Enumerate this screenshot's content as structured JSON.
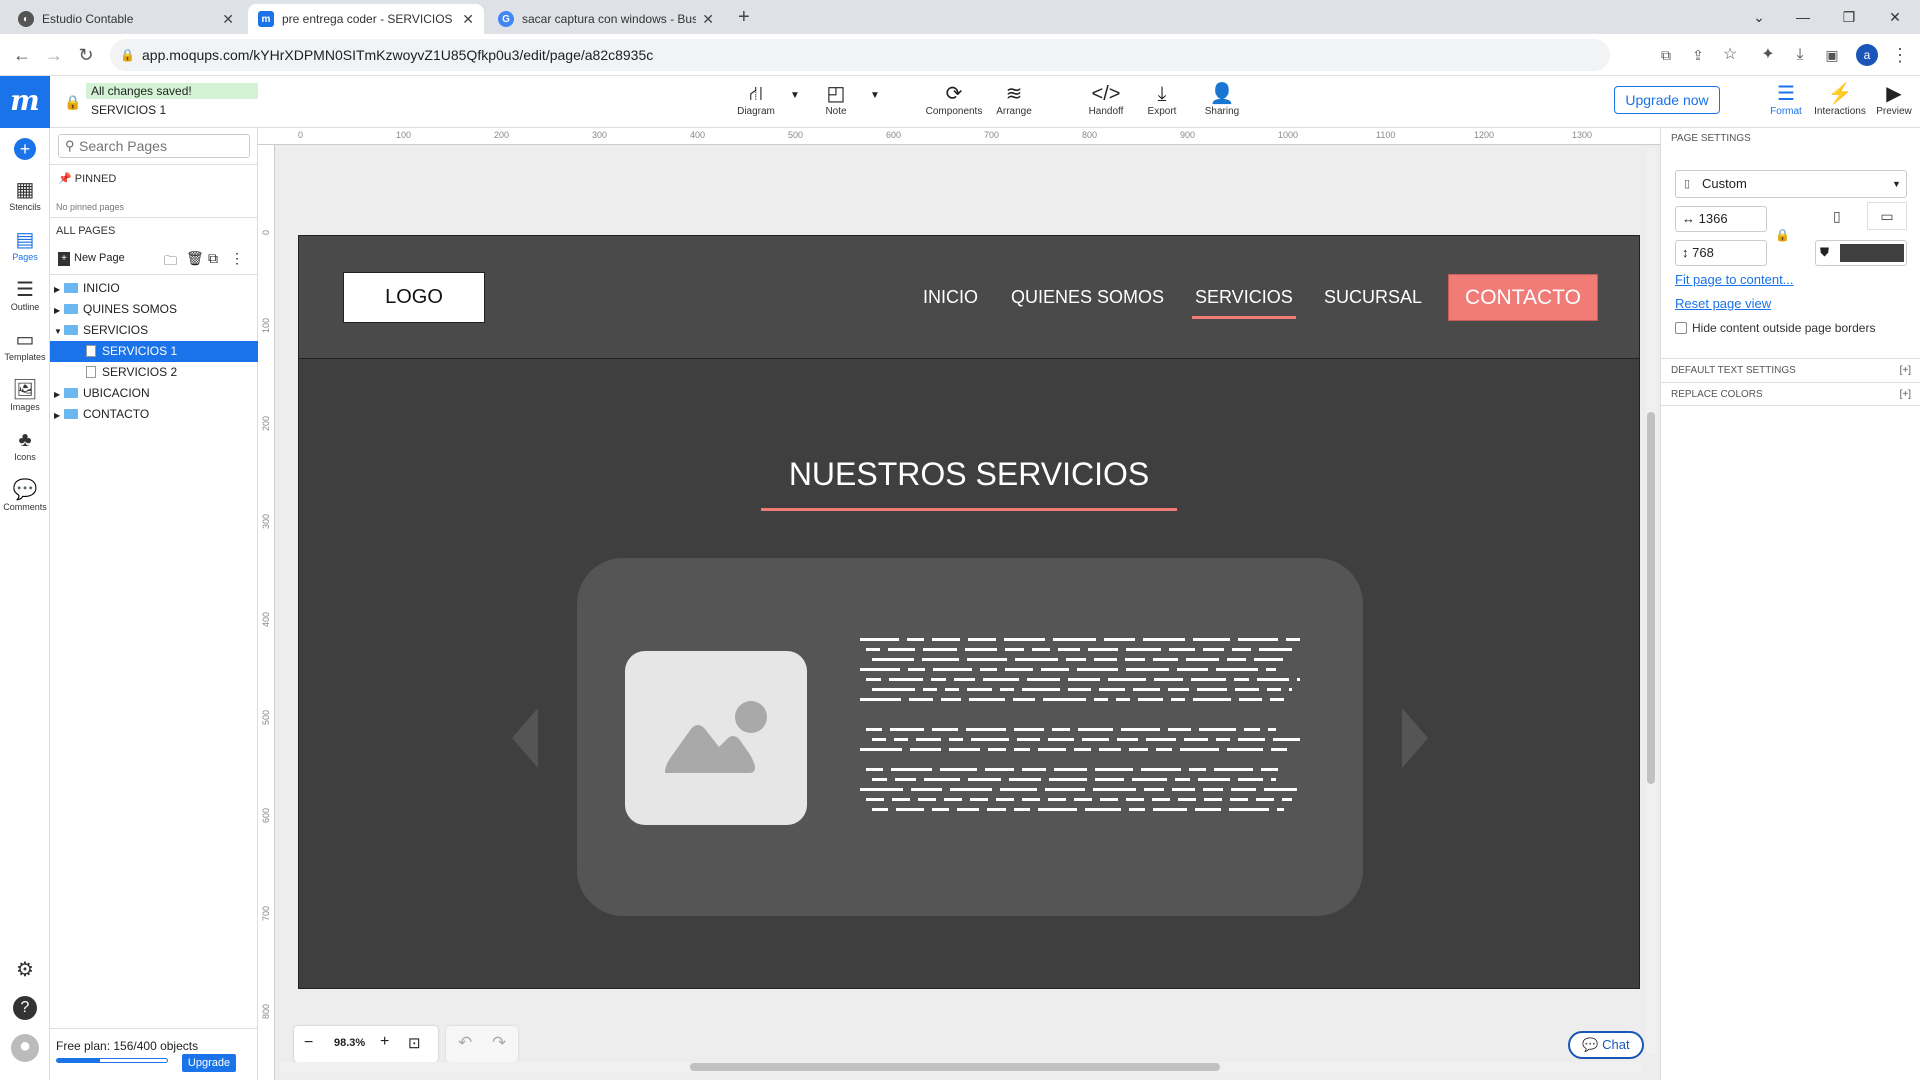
{
  "browser": {
    "tabs": [
      {
        "title": "Estudio Contable",
        "active": false
      },
      {
        "title": "pre entrega coder - SERVICIOS 1",
        "active": true
      },
      {
        "title": "sacar captura con windows - Bus",
        "active": false
      }
    ],
    "url": "app.moqups.com/kYHrXDPMN0SITmKzwoyvZ1U85Qfkp0u3/edit/page/a82c8935c",
    "profile_initial": "a"
  },
  "app": {
    "save_status": "All changes saved!",
    "page_name": "SERVICIOS 1",
    "toolbar": {
      "diagram": "Diagram",
      "note": "Note",
      "components": "Components",
      "arrange": "Arrange",
      "handoff": "Handoff",
      "export": "Export",
      "sharing": "Sharing",
      "upgrade": "Upgrade now",
      "format": "Format",
      "interactions": "Interactions",
      "preview": "Preview"
    },
    "rail": {
      "stencils": "Stencils",
      "pages": "Pages",
      "outline": "Outline",
      "templates": "Templates",
      "images": "Images",
      "icons": "Icons",
      "comments": "Comments"
    },
    "pages_panel": {
      "search_placeholder": "Search Pages",
      "pinned": "PINNED",
      "no_pinned": "No pinned pages",
      "all_pages": "ALL PAGES",
      "new_page": "New Page",
      "tree": [
        {
          "label": "INICIO",
          "type": "folder",
          "level": 0,
          "expanded": false
        },
        {
          "label": "QUINES SOMOS",
          "type": "folder",
          "level": 0,
          "expanded": false
        },
        {
          "label": "SERVICIOS",
          "type": "folder",
          "level": 0,
          "expanded": true
        },
        {
          "label": "SERVICIOS 1",
          "type": "page",
          "level": 1,
          "selected": true
        },
        {
          "label": "SERVICIOS 2",
          "type": "page",
          "level": 1
        },
        {
          "label": "UBICACION",
          "type": "folder",
          "level": 0,
          "expanded": false
        },
        {
          "label": "CONTACTO",
          "type": "folder",
          "level": 0,
          "expanded": false
        }
      ],
      "plan": "Free plan: 156/400 objects",
      "plan_used_fraction": 0.39,
      "upgrade": "Upgrade"
    },
    "rulers": {
      "top": [
        "0",
        "100",
        "200",
        "300",
        "400",
        "500",
        "600",
        "700",
        "800",
        "900",
        "1000",
        "1100",
        "1200",
        "1300"
      ],
      "left": [
        "0",
        "100",
        "200",
        "300",
        "400",
        "500",
        "600",
        "700",
        "800"
      ]
    },
    "zoom": "98.3%",
    "chat": "Chat",
    "right_panel": {
      "title": "PAGE SETTINGS",
      "preset": "Custom",
      "width": "1366",
      "height": "768",
      "fit": "Fit page to content...",
      "reset": "Reset page view",
      "hide_outside": "Hide content outside page borders",
      "default_text": "DEFAULT TEXT SETTINGS",
      "replace_colors": "REPLACE COLORS",
      "expand": "[+]",
      "page_color": "#3f3f3f"
    }
  },
  "mockup": {
    "logo": "LOGO",
    "nav": [
      "INICIO",
      "QUIENES SOMOS",
      "SERVICIOS",
      "SUCURSAL"
    ],
    "active_nav": "SERVICIOS",
    "contact": "CONTACTO",
    "heading": "NUESTROS SERVICIOS",
    "accent": "#f07b77"
  }
}
